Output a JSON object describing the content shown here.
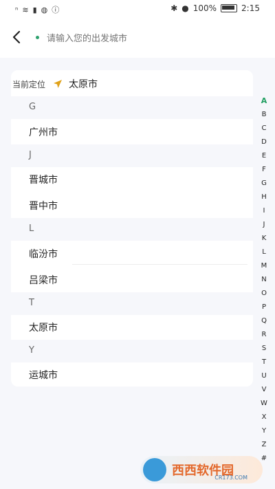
{
  "status_bar": {
    "battery": "100%",
    "time": "2:15"
  },
  "header": {
    "search_placeholder": "请输入您的出发城市"
  },
  "current_location": {
    "label": "当前定位",
    "city": "太原市"
  },
  "sections": [
    {
      "letter": "G",
      "cities": [
        "广州市"
      ]
    },
    {
      "letter": "J",
      "cities": [
        "晋城市",
        "晋中市"
      ]
    },
    {
      "letter": "L",
      "cities": [
        "临汾市",
        "吕梁市"
      ]
    },
    {
      "letter": "T",
      "cities": [
        "太原市"
      ]
    },
    {
      "letter": "Y",
      "cities": [
        "运城市"
      ]
    }
  ],
  "index_letters": [
    "A",
    "B",
    "C",
    "D",
    "E",
    "F",
    "G",
    "H",
    "I",
    "J",
    "K",
    "L",
    "M",
    "N",
    "O",
    "P",
    "Q",
    "R",
    "S",
    "T",
    "U",
    "V",
    "W",
    "X",
    "Y",
    "Z",
    "#"
  ],
  "index_active": "A",
  "colors": {
    "accent": "#1f9e5f",
    "background": "#f6f7fb"
  },
  "watermark": {
    "title": "西西软件园",
    "sub": "CR173.COM"
  }
}
